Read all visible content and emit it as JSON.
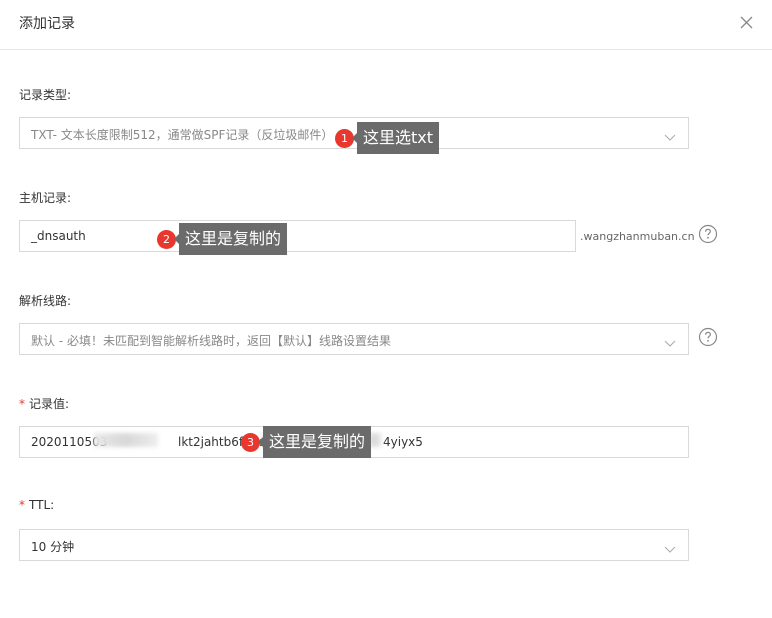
{
  "dialog": {
    "title": "添加记录",
    "close_icon": "close-icon"
  },
  "form": {
    "record_type": {
      "label": "记录类型:",
      "value": "TXT- 文本长度限制512，通常做SPF记录（反垃圾邮件）"
    },
    "host": {
      "label": "主机记录:",
      "value": "_dnsauth",
      "suffix": ".wangzhanmuban.cn"
    },
    "line": {
      "label": "解析线路:",
      "value": "默认 - 必填！未匹配到智能解析线路时，返回【默认】线路设置结果"
    },
    "record_value": {
      "required_mark": "*",
      "label": "记录值:",
      "value_start": "2020110503",
      "value_mid": "lkt2jahtb6ficzz",
      "value_end": "4yiyx5"
    },
    "ttl": {
      "required_mark": "*",
      "label": "TTL:",
      "value": "10 分钟"
    }
  },
  "annotations": [
    {
      "number": "1",
      "text": "这里选txt"
    },
    {
      "number": "2",
      "text": "这里是复制的"
    },
    {
      "number": "3",
      "text": "这里是复制的"
    }
  ],
  "icons": {
    "dropdown": "chevron-down-icon",
    "help": "question-circle-icon"
  },
  "colors": {
    "required": "#e8372e",
    "annotation_dot": "#e8372e",
    "annotation_box": "#6b6b6b",
    "border": "#d9d9d9"
  }
}
